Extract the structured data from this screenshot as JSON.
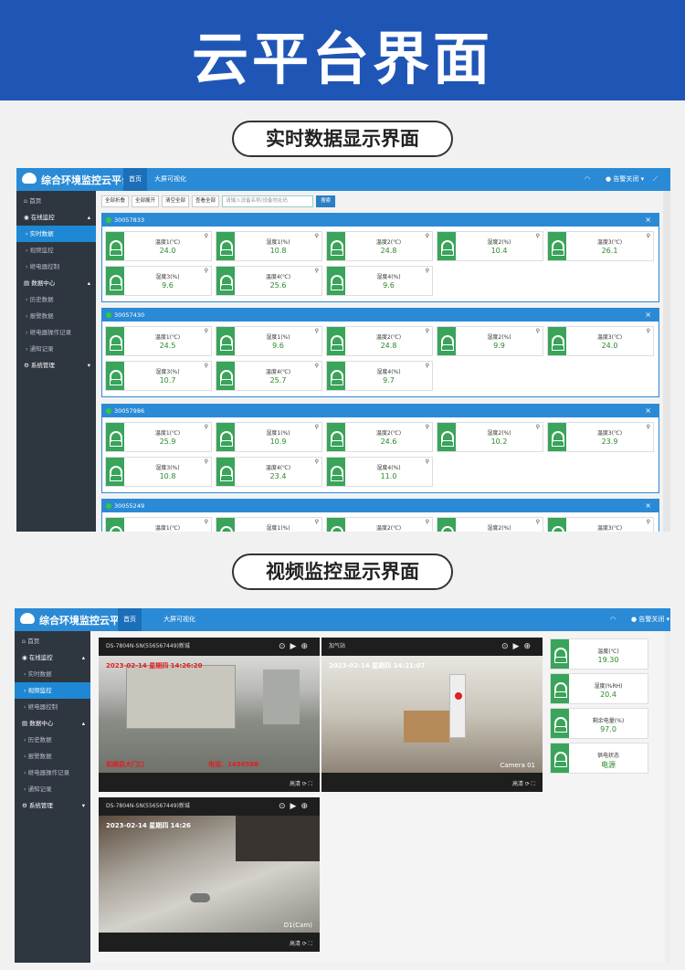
{
  "banner": {
    "title": "云平台界面"
  },
  "sections": {
    "realtime_label": "实时数据显示界面",
    "video_label": "视频监控显示界面"
  },
  "app": {
    "title": "综合环境监控云平台",
    "nav": [
      "首页",
      "大屏可视化"
    ],
    "alarm_off": "告警关闭"
  },
  "sidebar": {
    "items": [
      "首页",
      "在线监控",
      "实时数据",
      "视频监控",
      "继电器控制",
      "数据中心",
      "历史数据",
      "报警数据",
      "继电器操作记录",
      "通知记录",
      "系统管理"
    ]
  },
  "toolbar": {
    "buttons": [
      "全部折叠",
      "全部展开",
      "清空全部",
      "查看全部"
    ],
    "search_placeholder": "请输入设备名称/设备地址码",
    "search_button": "搜索"
  },
  "devices": [
    {
      "id": "30057833",
      "sensors": [
        {
          "name": "温度1(℃)",
          "value": "24.0"
        },
        {
          "name": "湿度1(%)",
          "value": "10.8"
        },
        {
          "name": "温度2(℃)",
          "value": "24.8"
        },
        {
          "name": "湿度2(%)",
          "value": "10.4"
        },
        {
          "name": "温度3(℃)",
          "value": "26.1"
        },
        {
          "name": "湿度3(%)",
          "value": "9.6"
        },
        {
          "name": "温度4(℃)",
          "value": "25.6"
        },
        {
          "name": "湿度4(%)",
          "value": "9.6"
        }
      ]
    },
    {
      "id": "30057430",
      "sensors": [
        {
          "name": "温度1(℃)",
          "value": "24.5"
        },
        {
          "name": "湿度1(%)",
          "value": "9.6"
        },
        {
          "name": "温度2(℃)",
          "value": "24.8"
        },
        {
          "name": "湿度2(%)",
          "value": "9.9"
        },
        {
          "name": "温度3(℃)",
          "value": "24.0"
        },
        {
          "name": "湿度3(%)",
          "value": "10.7"
        },
        {
          "name": "温度4(℃)",
          "value": "25.7"
        },
        {
          "name": "湿度4(%)",
          "value": "9.7"
        }
      ]
    },
    {
      "id": "30057986",
      "sensors": [
        {
          "name": "温度1(℃)",
          "value": "25.9"
        },
        {
          "name": "湿度1(%)",
          "value": "10.9"
        },
        {
          "name": "温度2(℃)",
          "value": "24.6"
        },
        {
          "name": "湿度2(%)",
          "value": "10.2"
        },
        {
          "name": "温度3(℃)",
          "value": "23.9"
        },
        {
          "name": "湿度3(%)",
          "value": "10.8"
        },
        {
          "name": "温度4(℃)",
          "value": "23.4"
        },
        {
          "name": "湿度4(%)",
          "value": "11.0"
        }
      ]
    },
    {
      "id": "30055249",
      "sensors": [
        {
          "name": "温度1(℃)",
          "value": ""
        },
        {
          "name": "湿度1(%)",
          "value": ""
        },
        {
          "name": "温度2(℃)",
          "value": ""
        },
        {
          "name": "湿度2(%)",
          "value": ""
        },
        {
          "name": "温度3(℃)",
          "value": ""
        }
      ]
    }
  ],
  "video": {
    "cameras": [
      {
        "title": "DS-7804N-SN(556567449)新城",
        "osd_top": "2023-02-14 星期四 14:26:20",
        "osd_bottom_left": "和顺县大门口",
        "osd_bottom_right": "电话：1436588"
      },
      {
        "title": "加气站",
        "osd_top": "2023-02-14 星期四 14:21:07",
        "osd_bottom_left": "",
        "osd_bottom_right": "Camera 01"
      },
      {
        "title": "DS-7804N-SN(556567449)新城",
        "osd_top": "2023-02-14 星期四 14:26",
        "osd_bottom_left": "",
        "osd_bottom_right": "D1(Cam)"
      }
    ],
    "quality": "高清",
    "stats": [
      {
        "name": "温度(℃)",
        "value": "19.30"
      },
      {
        "name": "湿度(%RH)",
        "value": "20.4"
      },
      {
        "name": "剩余电量(%)",
        "value": "97.0"
      },
      {
        "name": "供电状态",
        "value": "电源"
      }
    ]
  },
  "colors": {
    "banner": "#1f56b6",
    "topbar": "#2a8ad6",
    "sidebar": "#2e3640",
    "sensor_green": "#39a45a",
    "value_green": "#2a8a2a"
  }
}
